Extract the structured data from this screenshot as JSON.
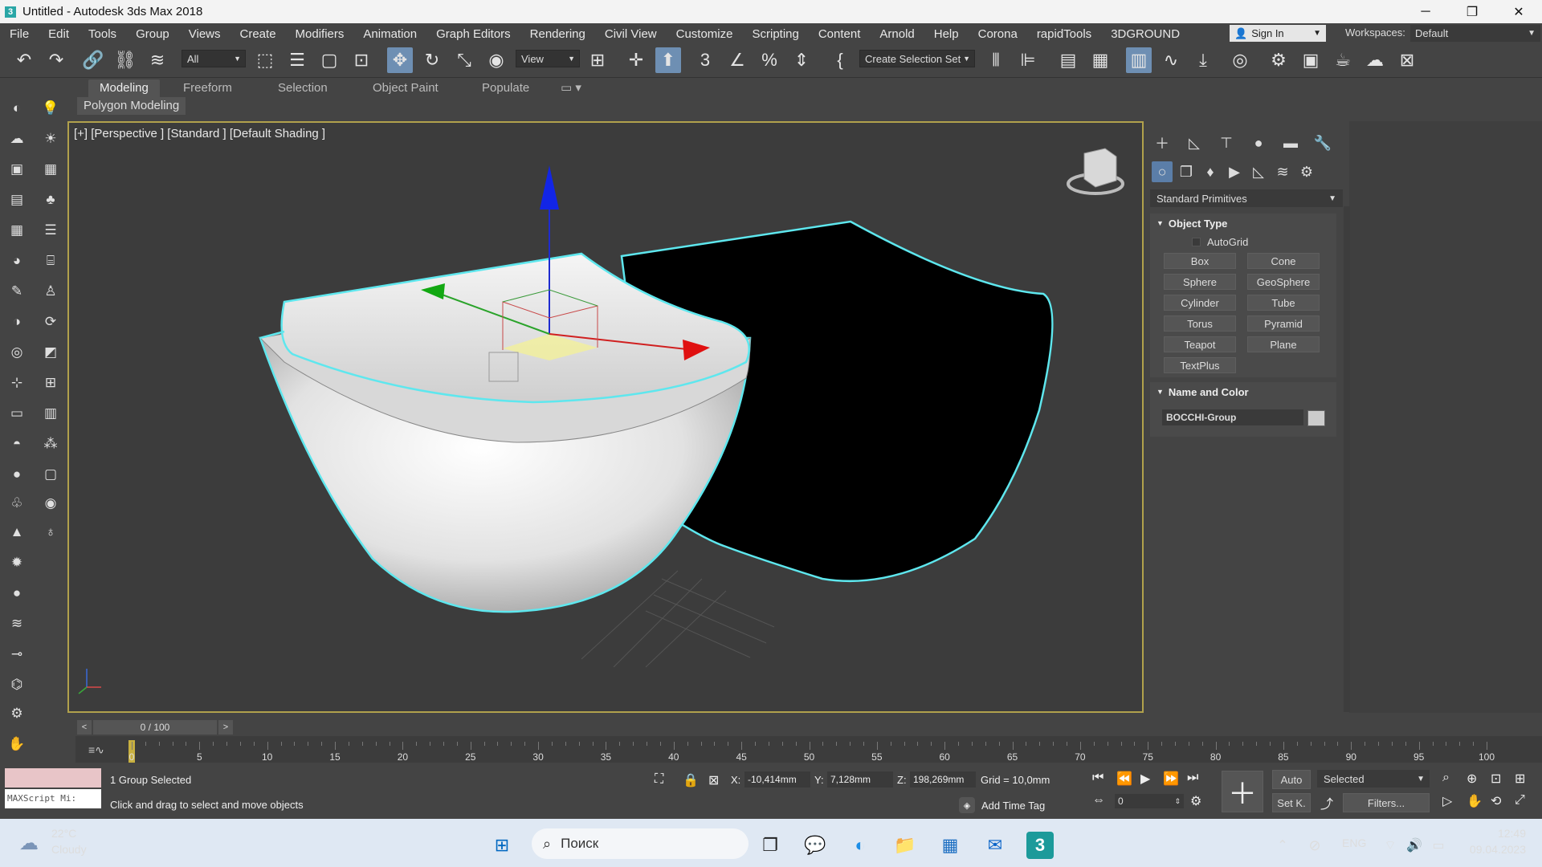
{
  "window": {
    "title": "Untitled - Autodesk 3ds Max 2018",
    "app_icon": "3",
    "minimize": "─",
    "maximize": "❐",
    "close": "✕"
  },
  "menu": {
    "items": [
      "File",
      "Edit",
      "Tools",
      "Group",
      "Views",
      "Create",
      "Modifiers",
      "Animation",
      "Graph Editors",
      "Rendering",
      "Civil View",
      "Customize",
      "Scripting",
      "Content",
      "Arnold",
      "Help",
      "Corona",
      "rapidTools",
      "3DGROUND"
    ],
    "signin": "Sign In",
    "workspaces_label": "Workspaces:",
    "workspace_value": "Default"
  },
  "toolbar": {
    "selection_filter": "All",
    "ref_coord": "View",
    "selection_set": "Create Selection Set"
  },
  "ribbon": {
    "tabs": [
      "Modeling",
      "Freeform",
      "Selection",
      "Object Paint",
      "Populate"
    ],
    "active_tab": "Modeling",
    "sub_label": "Polygon Modeling"
  },
  "viewport": {
    "label": "[+] [Perspective ] [Standard ] [Default Shading ]",
    "colors": {
      "border": "#b1a14c",
      "outline": "#5ee7ee",
      "background": "#3c3c3c"
    }
  },
  "command_panel": {
    "category": "Standard Primitives",
    "object_type_title": "Object Type",
    "autogrid": "AutoGrid",
    "buttons": [
      "Box",
      "Cone",
      "Sphere",
      "GeoSphere",
      "Cylinder",
      "Tube",
      "Torus",
      "Pyramid",
      "Teapot",
      "Plane",
      "TextPlus"
    ],
    "name_color_title": "Name and Color",
    "object_name": "BOCCHI-Group",
    "object_color": "#cccccc"
  },
  "timeline": {
    "frame_display": "0 / 100",
    "prev": "<",
    "next": ">",
    "tick_labels": [
      "0",
      "5",
      "10",
      "15",
      "20",
      "25",
      "30",
      "35",
      "40",
      "45",
      "50",
      "55",
      "60",
      "65",
      "70",
      "75",
      "80",
      "85",
      "90",
      "95",
      "100"
    ]
  },
  "status": {
    "maxscript_placeholder": "MAXScript Mi:",
    "line1": "1 Group Selected",
    "line2": "Click and drag to select and move objects",
    "x_label": "X:",
    "x_value": "-10,414mm",
    "y_label": "Y:",
    "y_value": "7,128mm",
    "z_label": "Z:",
    "z_value": "198,269mm",
    "grid": "Grid = 10,0mm",
    "add_time_tag": "Add Time Tag",
    "key_frame": "0",
    "auto": "Auto",
    "set_key": "Set K.",
    "selected": "Selected",
    "filters": "Filters..."
  },
  "taskbar": {
    "temperature": "22°C",
    "condition": "Cloudy",
    "search_placeholder": "Поиск",
    "language": "ENG",
    "time": "12:49",
    "date": "09.04.2023"
  }
}
